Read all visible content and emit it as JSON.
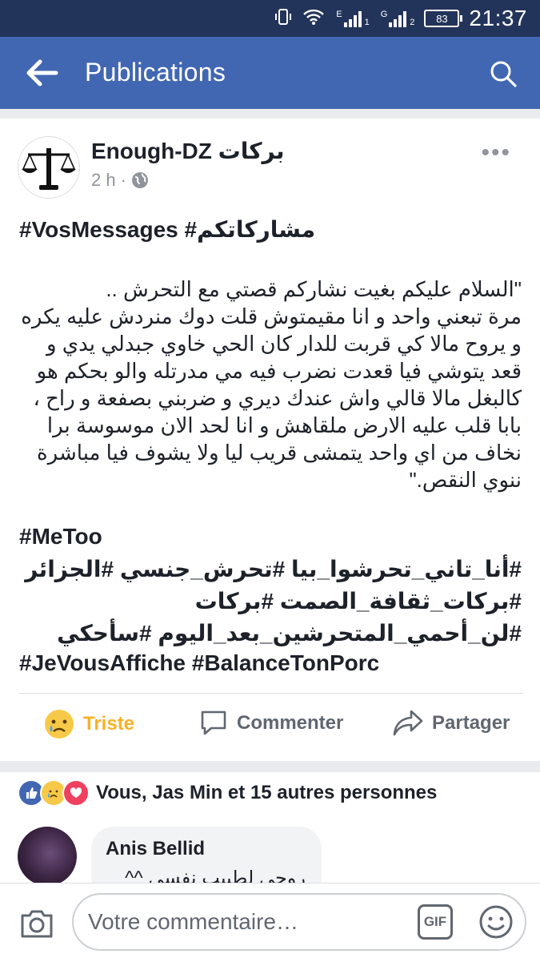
{
  "status_bar": {
    "battery": "83",
    "sim1": "1",
    "sim2": "2",
    "net1": "E",
    "net2": "G",
    "time": "21:37"
  },
  "app_bar": {
    "title": "Publications",
    "color": "#4267b2"
  },
  "post": {
    "author": "Enough-DZ بركات",
    "time": "2 h",
    "hashtags_top": "#VosMessages #مشاركاتكم",
    "body": [
      "\"السلام عليكم بغيت نشاركم قصتي مع التحرش ..",
      "مرة تبعني واحد و انا مقيمتوش قلت دوك منردش عليه يكره",
      "و يروح مالا كي قربت للدار كان الحي خاوي جبدلي يدي و",
      "قعد يتوشي فيا قعدت نضرب فيه مي مدرتله والو بحكم هو",
      "كالبغل مالا قالي واش عندك ديري و ضربني بصفعة و راح ،",
      "بابا قلب عليه الارض ملقاهش و انا لحد الان موسوسة برا",
      "نخاف من اي واحد يتمشى قريب ليا ولا يشوف فيا مباشرة",
      "ننوي النقص.\""
    ],
    "tag_metoo": "#MeToo",
    "tags_ar_1": "#أنا_تاني_تحرشوا_بيا #تحرش_جنسي #الجزائر",
    "tags_ar_2": "#بركات_ثقافة_الصمت #بركات",
    "tags_ar_3": "#لن_أحمي_المتحرشين_بعد_اليوم #سأحكي",
    "tags_bottom": "#JeVousAffiche #BalanceTonPorc"
  },
  "actions": {
    "reaction": "Triste",
    "comment": "Commenter",
    "share": "Partager"
  },
  "reactions_summary": "Vous, Jas Min et 15 autres personnes",
  "comment": {
    "author": "Anis Bellid",
    "text": "روحي لطبيب نفسي ^^"
  },
  "composer": {
    "placeholder": "Votre commentaire…",
    "gif_label": "GIF"
  }
}
